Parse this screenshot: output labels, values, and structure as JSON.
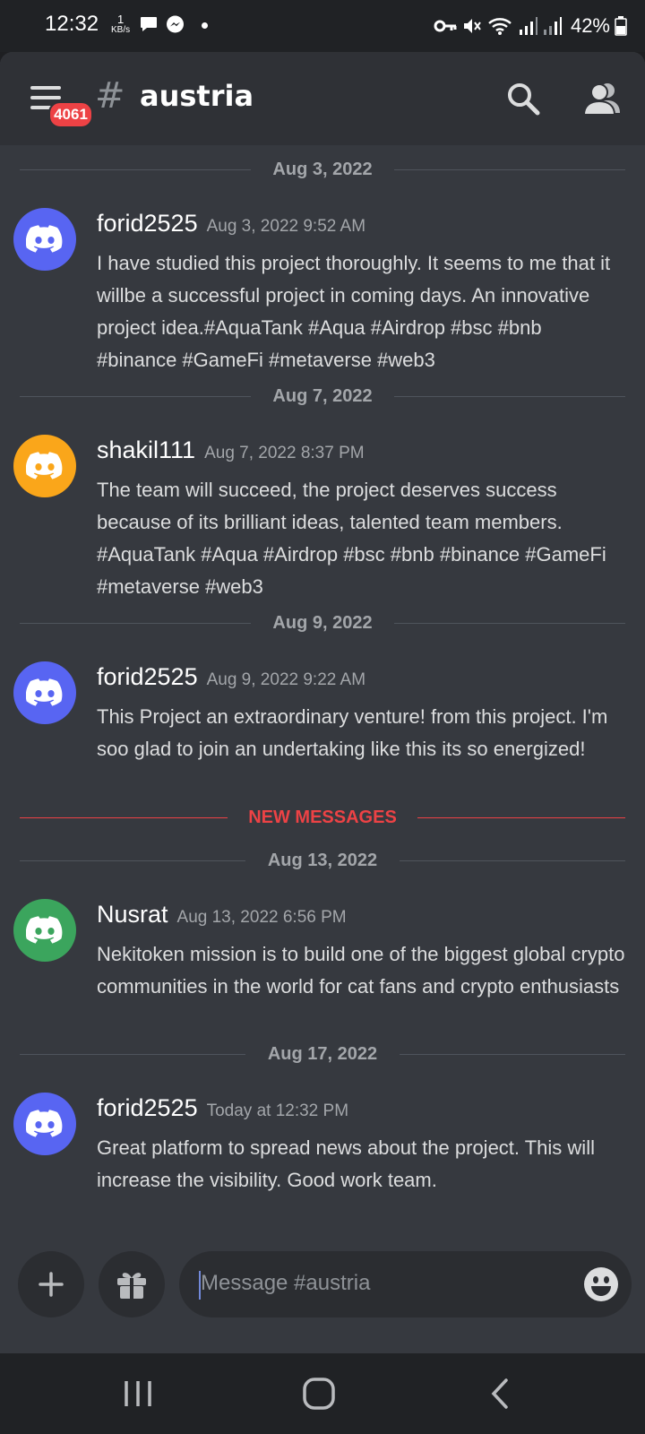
{
  "status_bar": {
    "time": "12:32",
    "net_speed_value": "1",
    "net_speed_unit": "KB/s",
    "battery": "42%"
  },
  "header": {
    "unread_count": "4061",
    "channel_hash": "#",
    "channel_name": "austria"
  },
  "colors": {
    "blurple": "#5865f2",
    "orange": "#faa61a",
    "green": "#3ba55d",
    "new_messages_red": "#ed4245"
  },
  "messages": [
    {
      "date_divider": "Aug 3, 2022",
      "username": "forid2525",
      "timestamp": "Aug 3, 2022 9:52 AM",
      "avatar_color": "#5865f2",
      "text": "I have studied this project thoroughly. It seems to me that it willbe a successful project in coming days. An innovative project idea.#AquaTank #Aqua #Airdrop #bsc #bnb #binance #GameFi #metaverse #web3"
    },
    {
      "date_divider": "Aug 7, 2022",
      "username": "shakil111",
      "timestamp": "Aug 7, 2022 8:37 PM",
      "avatar_color": "#faa61a",
      "text": "The team will succeed, the project deserves success because of its brilliant ideas, talented team members. #AquaTank #Aqua #Airdrop #bsc #bnb #binance #GameFi #metaverse #web3"
    },
    {
      "date_divider": "Aug 9, 2022",
      "username": "forid2525",
      "timestamp": "Aug 9, 2022 9:22 AM",
      "avatar_color": "#5865f2",
      "text": "This Project an extraordinary venture!  from this project. I'm soo glad to join an undertaking like this its so energized!"
    },
    {
      "date_divider": "Aug 13, 2022",
      "username": "Nusrat",
      "timestamp": "Aug 13, 2022 6:56 PM",
      "avatar_color": "#3ba55d",
      "text": "Nekitoken mission is to build one of the biggest global crypto communities in the world for cat fans and crypto enthusiasts"
    },
    {
      "date_divider": "Aug 17, 2022",
      "username": "forid2525",
      "timestamp": "Today at 12:32 PM",
      "avatar_color": "#5865f2",
      "text": "Great platform to spread news about the project. This will increase the visibility. Good work team."
    }
  ],
  "new_messages_label": "NEW MESSAGES",
  "composer": {
    "placeholder": "Message #austria"
  },
  "icons": {
    "hamburger": "hamburger-menu-icon",
    "search": "search-icon",
    "members": "members-icon",
    "add": "plus-icon",
    "gift": "gift-icon",
    "emoji": "emoji-icon",
    "avatar": "discord-logo-icon"
  }
}
